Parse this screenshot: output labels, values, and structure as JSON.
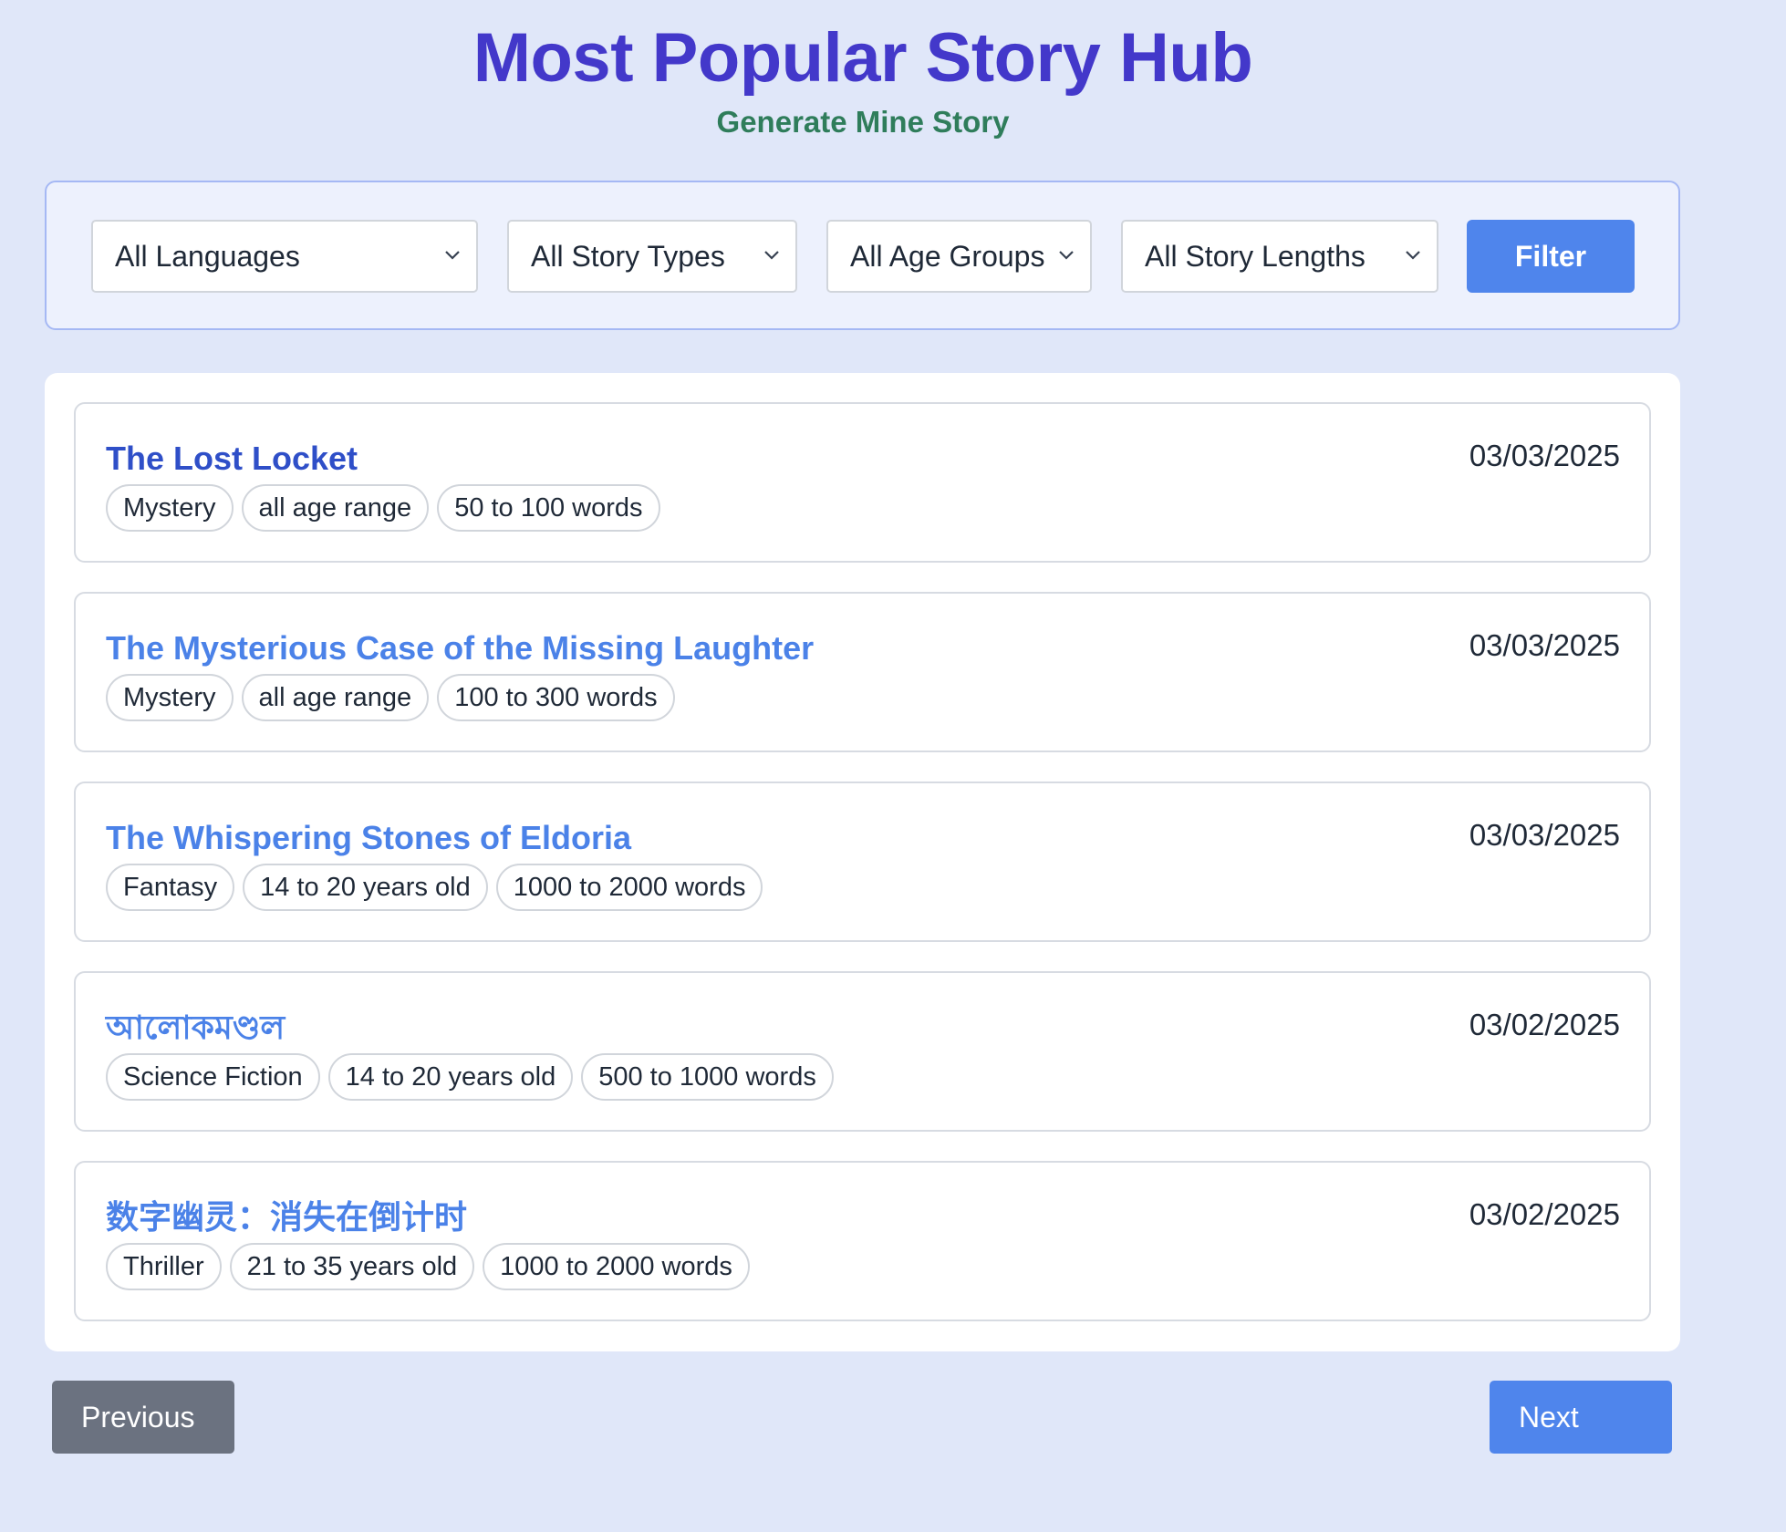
{
  "header": {
    "title": "Most Popular Story Hub",
    "subtitle": "Generate Mine Story"
  },
  "filters": {
    "language": "All Languages",
    "story_type": "All Story Types",
    "age_group": "All Age Groups",
    "story_length": "All Story Lengths",
    "filter_label": "Filter"
  },
  "stories": [
    {
      "title": "The Lost Locket",
      "date": "03/03/2025",
      "tags": [
        "Mystery",
        "all age range",
        "50 to 100 words"
      ]
    },
    {
      "title": "The Mysterious Case of the Missing Laughter",
      "date": "03/03/2025",
      "tags": [
        "Mystery",
        "all age range",
        "100 to 300 words"
      ]
    },
    {
      "title": "The Whispering Stones of Eldoria",
      "date": "03/03/2025",
      "tags": [
        "Fantasy",
        "14 to 20 years old",
        "1000 to 2000 words"
      ]
    },
    {
      "title": "আলোকমণ্ডল",
      "date": "03/02/2025",
      "tags": [
        "Science Fiction",
        "14 to 20 years old",
        "500 to 1000 words"
      ]
    },
    {
      "title": "数字幽灵：消失在倒计时",
      "date": "03/02/2025",
      "tags": [
        "Thriller",
        "21 to 35 years old",
        "1000 to 2000 words"
      ]
    }
  ],
  "pagination": {
    "previous_label": "Previous",
    "next_label": "Next"
  },
  "colors": {
    "background": "#e0e7f9",
    "title": "#4338ca",
    "subtitle": "#2f7d5b",
    "accent": "#4f85ec",
    "secondary_button": "#6b7280"
  }
}
